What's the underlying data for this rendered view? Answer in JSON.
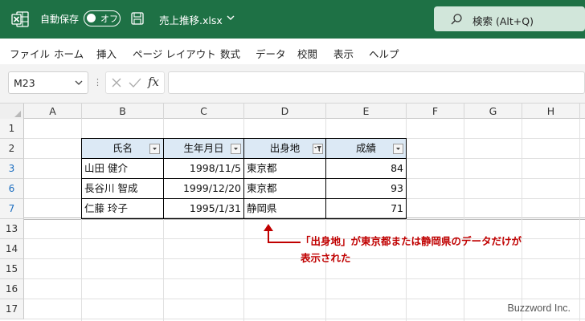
{
  "titlebar": {
    "autosave_label": "自動保存",
    "autosave_state": "オフ",
    "filename": "売上推移.xlsx",
    "search_label": "検索 (Alt+Q)"
  },
  "menu": [
    "ファイル",
    "ホーム",
    "挿入",
    "ページ レイアウト",
    "数式",
    "データ",
    "校閲",
    "表示",
    "ヘルプ"
  ],
  "formula_bar": {
    "name_box": "M23",
    "fx_label": "fx",
    "formula": ""
  },
  "grid": {
    "columns": [
      "A",
      "B",
      "C",
      "D",
      "E",
      "F",
      "G",
      "H"
    ],
    "rows": [
      "1",
      "2",
      "3",
      "6",
      "7",
      "13",
      "14",
      "15",
      "16",
      "17"
    ],
    "filtered_rows": [
      "3",
      "6",
      "7"
    ]
  },
  "table": {
    "headers": [
      "氏名",
      "生年月日",
      "出身地",
      "成績"
    ],
    "filtered_column": "出身地",
    "rows": [
      [
        "山田 健介",
        "1998/11/5",
        "東京都",
        "84"
      ],
      [
        "長谷川 智成",
        "1999/12/20",
        "東京都",
        "93"
      ],
      [
        "仁藤 玲子",
        "1995/1/31",
        "静岡県",
        "71"
      ]
    ]
  },
  "annotation": {
    "line1": "「出身地」が東京都または静岡県のデータだけが",
    "line2": "表示された",
    "color": "#c00000"
  },
  "watermark": "Buzzword Inc."
}
